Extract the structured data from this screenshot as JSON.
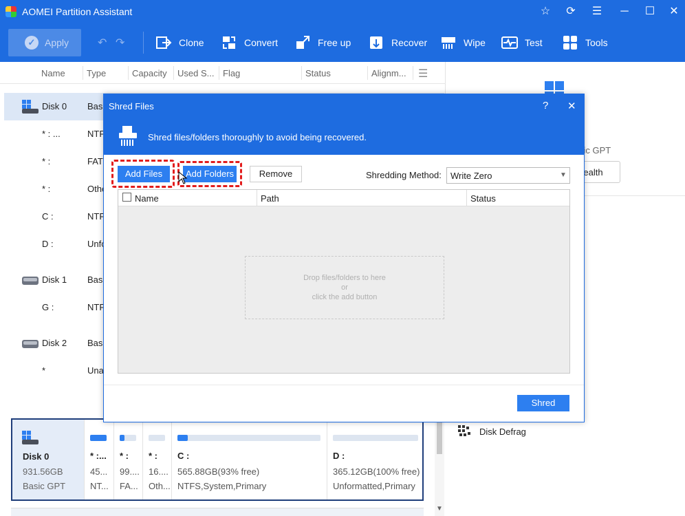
{
  "app": {
    "title": "AOMEI Partition Assistant"
  },
  "toolbar": {
    "apply": "Apply",
    "tools": [
      {
        "label": "Clone",
        "icon": "clone-icon"
      },
      {
        "label": "Convert",
        "icon": "convert-icon"
      },
      {
        "label": "Free up",
        "icon": "free-up-icon"
      },
      {
        "label": "Recover",
        "icon": "recover-icon"
      },
      {
        "label": "Wipe",
        "icon": "wipe-icon"
      },
      {
        "label": "Test",
        "icon": "test-icon"
      },
      {
        "label": "Tools",
        "icon": "tools-icon"
      }
    ]
  },
  "columns": [
    "Name",
    "Type",
    "Capacity",
    "Used S...",
    "Flag",
    "Status",
    "Alignm..."
  ],
  "rows": [
    {
      "name": "Disk 0",
      "type": "Basi",
      "kind": "disk"
    },
    {
      "name": "* : ...",
      "type": "NTF",
      "kind": "part"
    },
    {
      "name": "* :",
      "type": "FAT",
      "kind": "part"
    },
    {
      "name": "* :",
      "type": "Othe",
      "kind": "part"
    },
    {
      "name": "C :",
      "type": "NTF",
      "kind": "part"
    },
    {
      "name": "D :",
      "type": "Unfo",
      "kind": "part"
    },
    {
      "name": "Disk 1",
      "type": "Basi",
      "kind": "disk"
    },
    {
      "name": "G :",
      "type": "NTF",
      "kind": "part"
    },
    {
      "name": "Disk 2",
      "type": "Basi",
      "kind": "disk"
    },
    {
      "name": "*",
      "type": "Una",
      "kind": "part"
    }
  ],
  "right_panel": {
    "disk_type": "sic GPT",
    "health_button": "Health",
    "disk_defrag": "Disk Defrag"
  },
  "diskmap": {
    "disk": {
      "name": "Disk 0",
      "size": "931.56GB",
      "type": "Basic GPT"
    },
    "segments": [
      {
        "name": "* :...",
        "size": "45...",
        "fs": "NT...",
        "fill": 1.0
      },
      {
        "name": "* :",
        "size": "99....",
        "fs": "FA...",
        "fill": 0.3
      },
      {
        "name": "* :",
        "size": "16....",
        "fs": "Oth...",
        "fill": 0.0
      },
      {
        "name": "C :",
        "size": "565.88GB(93% free)",
        "fs": "NTFS,System,Primary",
        "fill": 0.07
      },
      {
        "name": "D :",
        "size": "365.12GB(100% free)",
        "fs": "Unformatted,Primary",
        "fill": 0.0
      }
    ]
  },
  "dialog": {
    "title": "Shred Files",
    "help": "?",
    "close": "✕",
    "description": "Shred files/folders thoroughly to avoid being recovered.",
    "add_files": "Add Files",
    "add_folders": "Add Folders",
    "remove": "Remove",
    "method_label": "Shredding Method:",
    "method_value": "Write Zero",
    "table_headers": {
      "name": "Name",
      "path": "Path",
      "status": "Status"
    },
    "drop_line1": "Drop files/folders to here",
    "drop_line2": "or",
    "drop_line3": "click the add button",
    "shred": "Shred"
  },
  "colors": {
    "accent": "#1e6ce0",
    "button_blue": "#2d7ff0",
    "highlight_red": "#e21c1c"
  }
}
